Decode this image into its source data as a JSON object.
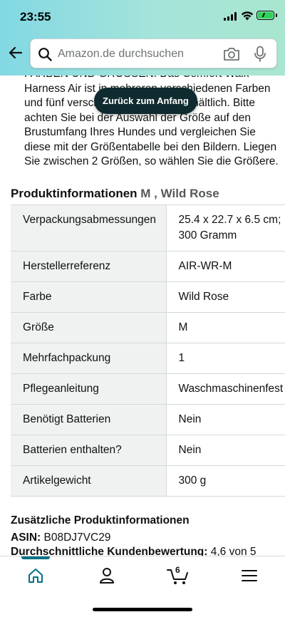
{
  "status_bar": {
    "time": "23:55"
  },
  "search": {
    "placeholder": "Amazon.de durchsuchen"
  },
  "bullet": {
    "text": "FARBEN UND GRÖSSEN: Das Comfort Walk Harness Air ist in mehreren verschiedenen Farben und fünf verschiedenen Größen erhältlich. Bitte achten Sie bei der Auswahl der Größe auf den Brustumfang Ihres Hundes und vergleichen Sie diese mit der Größentabelle bei den Bildern. Liegen Sie zwischen 2 Größen, so wählen Sie die Größere."
  },
  "toast": {
    "label": "Zurück zum Anfang"
  },
  "product_info": {
    "title": "Produktinformationen",
    "variant": "M , Wild Rose",
    "rows": [
      {
        "key": "Verpackungsabmessungen",
        "value": "25.4 x 22.7 x 6.5 cm; 300 Gramm"
      },
      {
        "key": "Herstellerreferenz",
        "value": "AIR-WR-M"
      },
      {
        "key": "Farbe",
        "value": "Wild Rose"
      },
      {
        "key": "Größe",
        "value": "M"
      },
      {
        "key": "Mehrfachpackung",
        "value": "1"
      },
      {
        "key": "Pflegeanleitung",
        "value": "Waschmaschinenfest"
      },
      {
        "key": "Benötigt Batterien",
        "value": "Nein"
      },
      {
        "key": "Batterien enthalten?",
        "value": "Nein"
      },
      {
        "key": "Artikelgewicht",
        "value": "300 g"
      }
    ]
  },
  "additional": {
    "title": "Zusätzliche Produktinformationen",
    "asin_label": "ASIN:",
    "asin_value": "B08DJ7VC29",
    "rating_label": "Durchschnittliche Kundenbewertung:",
    "rating_value": "4,6 von 5"
  },
  "nav": {
    "cart_count": "6",
    "accent": "#007185",
    "items": [
      "home-icon",
      "account-icon",
      "cart-icon",
      "menu-icon"
    ]
  },
  "colors": {
    "fab": "#ffd814",
    "toast": "#0f2b2f"
  }
}
